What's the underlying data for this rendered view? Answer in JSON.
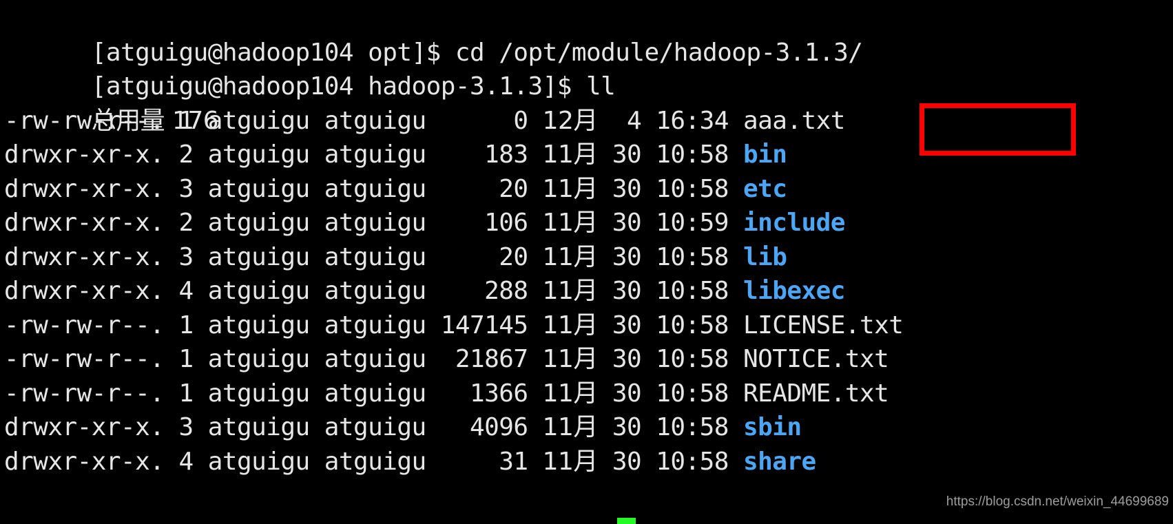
{
  "terminal": {
    "background_color": "#000000",
    "foreground_color": "#e6e6e6",
    "directory_color": "#4ba7f5",
    "highlight_color": "#ff0000",
    "cursor_color": "#24fa24",
    "prompt_lines": [
      {
        "id": "prompt-cd",
        "text": "[atguigu@hadoop104 opt]$ cd /opt/module/hadoop-3.1.3/"
      },
      {
        "id": "prompt-ll",
        "text": "[atguigu@hadoop104 hadoop-3.1.3]$ ll"
      }
    ],
    "total_line": "总用量 176",
    "listing": [
      {
        "permissions": "-rw-rw-r--.",
        "links": "1",
        "owner": "atguigu",
        "group": "atguigu",
        "size": "0",
        "month": "12月",
        "day": "4",
        "time": "16:34",
        "name": "aaa.txt",
        "type": "file",
        "highlighted": true
      },
      {
        "permissions": "drwxr-xr-x.",
        "links": "2",
        "owner": "atguigu",
        "group": "atguigu",
        "size": "183",
        "month": "11月",
        "day": "30",
        "time": "10:58",
        "name": "bin",
        "type": "directory",
        "highlighted": false
      },
      {
        "permissions": "drwxr-xr-x.",
        "links": "3",
        "owner": "atguigu",
        "group": "atguigu",
        "size": "20",
        "month": "11月",
        "day": "30",
        "time": "10:58",
        "name": "etc",
        "type": "directory",
        "highlighted": false
      },
      {
        "permissions": "drwxr-xr-x.",
        "links": "2",
        "owner": "atguigu",
        "group": "atguigu",
        "size": "106",
        "month": "11月",
        "day": "30",
        "time": "10:59",
        "name": "include",
        "type": "directory",
        "highlighted": false
      },
      {
        "permissions": "drwxr-xr-x.",
        "links": "3",
        "owner": "atguigu",
        "group": "atguigu",
        "size": "20",
        "month": "11月",
        "day": "30",
        "time": "10:58",
        "name": "lib",
        "type": "directory",
        "highlighted": false
      },
      {
        "permissions": "drwxr-xr-x.",
        "links": "4",
        "owner": "atguigu",
        "group": "atguigu",
        "size": "288",
        "month": "11月",
        "day": "30",
        "time": "10:58",
        "name": "libexec",
        "type": "directory",
        "highlighted": false
      },
      {
        "permissions": "-rw-rw-r--.",
        "links": "1",
        "owner": "atguigu",
        "group": "atguigu",
        "size": "147145",
        "month": "11月",
        "day": "30",
        "time": "10:58",
        "name": "LICENSE.txt",
        "type": "file",
        "highlighted": false
      },
      {
        "permissions": "-rw-rw-r--.",
        "links": "1",
        "owner": "atguigu",
        "group": "atguigu",
        "size": "21867",
        "month": "11月",
        "day": "30",
        "time": "10:58",
        "name": "NOTICE.txt",
        "type": "file",
        "highlighted": false
      },
      {
        "permissions": "-rw-rw-r--.",
        "links": "1",
        "owner": "atguigu",
        "group": "atguigu",
        "size": "1366",
        "month": "11月",
        "day": "30",
        "time": "10:58",
        "name": "README.txt",
        "type": "file",
        "highlighted": false
      },
      {
        "permissions": "drwxr-xr-x.",
        "links": "3",
        "owner": "atguigu",
        "group": "atguigu",
        "size": "4096",
        "month": "11月",
        "day": "30",
        "time": "10:58",
        "name": "sbin",
        "type": "directory",
        "highlighted": false
      },
      {
        "permissions": "drwxr-xr-x.",
        "links": "4",
        "owner": "atguigu",
        "group": "atguigu",
        "size": "31",
        "month": "11月",
        "day": "30",
        "time": "10:58",
        "name": "share",
        "type": "directory",
        "highlighted": false
      }
    ]
  },
  "watermark": {
    "text": "https://blog.csdn.net/weixin_44699689"
  }
}
